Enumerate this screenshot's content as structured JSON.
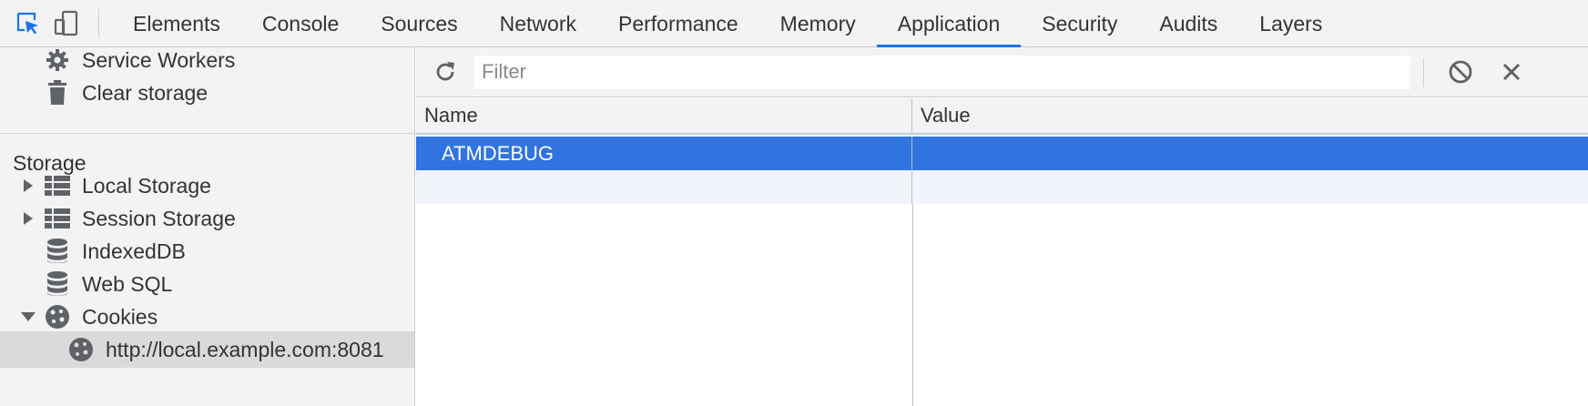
{
  "toolbar": {
    "inspect_icon": "inspect-element-icon",
    "device_icon": "device-toolbar-icon",
    "tabs": [
      {
        "label": "Elements",
        "active": false
      },
      {
        "label": "Console",
        "active": false
      },
      {
        "label": "Sources",
        "active": false
      },
      {
        "label": "Network",
        "active": false
      },
      {
        "label": "Performance",
        "active": false
      },
      {
        "label": "Memory",
        "active": false
      },
      {
        "label": "Application",
        "active": true
      },
      {
        "label": "Security",
        "active": false
      },
      {
        "label": "Audits",
        "active": false
      },
      {
        "label": "Layers",
        "active": false
      }
    ],
    "accent_color": "#1a73e8"
  },
  "sidebar": {
    "app_items": [
      {
        "label": "Service Workers",
        "icon": "gear-icon"
      },
      {
        "label": "Clear storage",
        "icon": "trash-icon"
      }
    ],
    "storage_header": "Storage",
    "storage_items": [
      {
        "label": "Local Storage",
        "icon": "grid-icon",
        "expander": "collapsed"
      },
      {
        "label": "Session Storage",
        "icon": "grid-icon",
        "expander": "collapsed"
      },
      {
        "label": "IndexedDB",
        "icon": "database-icon",
        "expander": "none"
      },
      {
        "label": "Web SQL",
        "icon": "database-icon",
        "expander": "none"
      },
      {
        "label": "Cookies",
        "icon": "cookie-icon",
        "expander": "expanded"
      }
    ],
    "cookie_origin": {
      "label": "http://local.example.com:8081",
      "icon": "cookie-icon",
      "selected": true
    }
  },
  "main": {
    "refresh_icon": "refresh-icon",
    "filter": {
      "placeholder": "Filter",
      "value": ""
    },
    "clear_icon": "clear-all-icon",
    "delete_icon": "close-icon",
    "columns": [
      "Name",
      "Value"
    ],
    "rows": [
      {
        "name": "ATMDEBUG",
        "value": "",
        "selected": true
      }
    ],
    "selection_color": "#3174e0"
  }
}
